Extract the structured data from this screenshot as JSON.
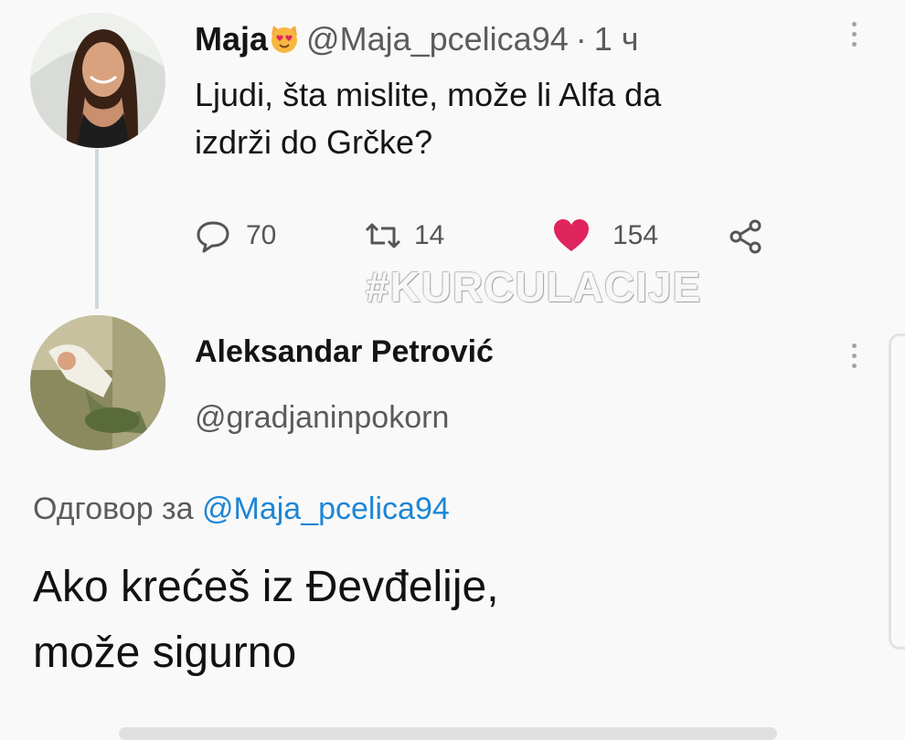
{
  "tweet1": {
    "name": "Maja",
    "handle": "@Maja_pcelica94",
    "separator": "·",
    "time": "1 ч",
    "text_line1": "Ljudi, šta mislite, može li Alfa da",
    "text_line2": "izdrži do Grčke?",
    "replies": "70",
    "retweets": "14",
    "likes": "154"
  },
  "watermark": "#KURCULACIJE",
  "tweet2": {
    "name": "Aleksandar Petrović",
    "handle": "@gradjaninpokorn",
    "reply_prefix": "Одговор за",
    "reply_mention": "@Maja_pcelica94",
    "text_line1": "Ako krećeš iz Đevđelije,",
    "text_line2": "može sigurno"
  },
  "icons": [
    "cat-heart-eyes-emoji-icon",
    "more-vertical-icon",
    "reply-icon",
    "retweet-icon",
    "heart-icon",
    "share-icon"
  ],
  "colors": {
    "mention": "#1d86d6",
    "like": "#e0245e",
    "thread_line": "#cfd9de"
  }
}
